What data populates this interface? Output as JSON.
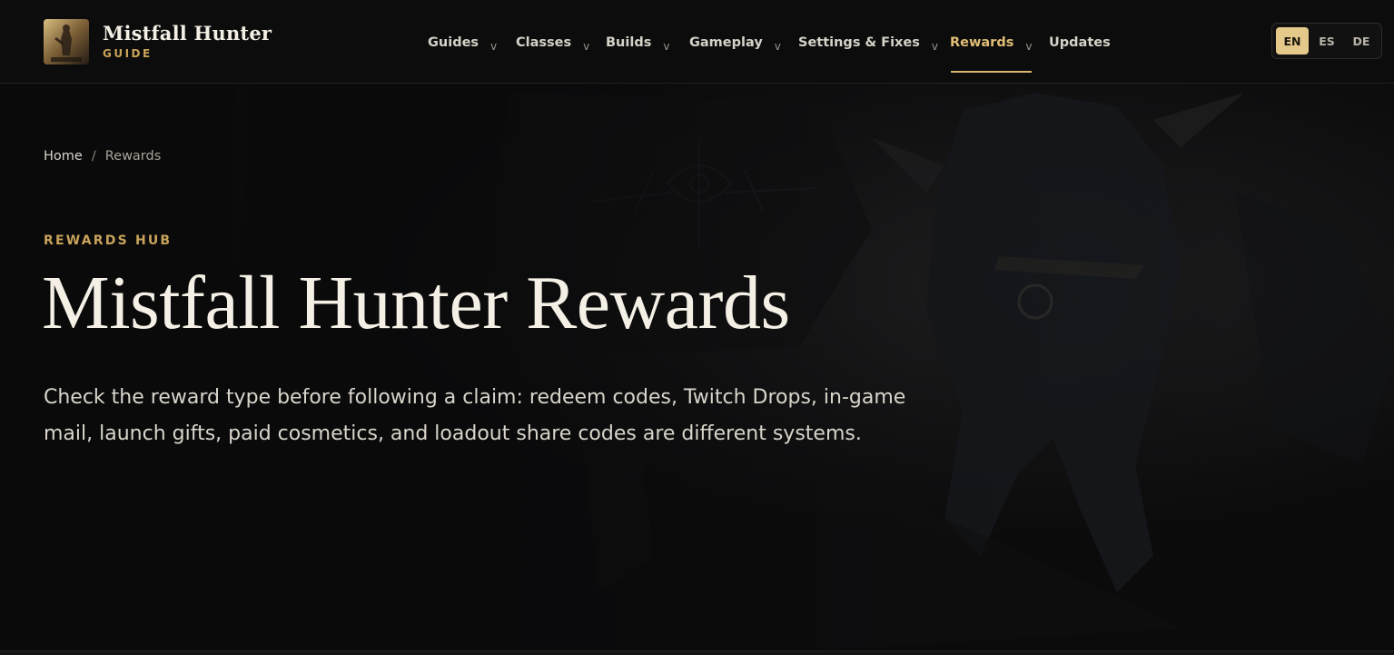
{
  "brand": {
    "title": "Mistfall Hunter",
    "subtitle": "GUIDE",
    "logo_icon": "game-cover-icon"
  },
  "nav": {
    "items": [
      {
        "label": "Guides",
        "has_dropdown": true
      },
      {
        "label": "Classes",
        "has_dropdown": true
      },
      {
        "label": "Builds",
        "has_dropdown": true
      },
      {
        "label": "Gameplay",
        "has_dropdown": true
      },
      {
        "label": "Settings & Fixes",
        "has_dropdown": true
      },
      {
        "label": "Rewards",
        "has_dropdown": true,
        "active": true
      },
      {
        "label": "Updates",
        "has_dropdown": false
      }
    ],
    "chevron": "v",
    "active_color": "#e0bd74"
  },
  "languages": {
    "options": [
      "EN",
      "ES",
      "DE"
    ],
    "selected": "EN",
    "accent": "#e4c98a"
  },
  "breadcrumb": {
    "home": "Home",
    "separator": "/",
    "current": "Rewards"
  },
  "hero": {
    "eyebrow": "REWARDS HUB",
    "title": "Mistfall Hunter Rewards",
    "description": "Check the reward type before following a claim: redeem codes, Twitch Drops, in-game mail, launch gifts, paid cosmetics, and loadout share codes are different systems."
  },
  "colors": {
    "background": "#0b0b0c",
    "gold": "#c9a35a",
    "text": "#f4f0e6"
  }
}
